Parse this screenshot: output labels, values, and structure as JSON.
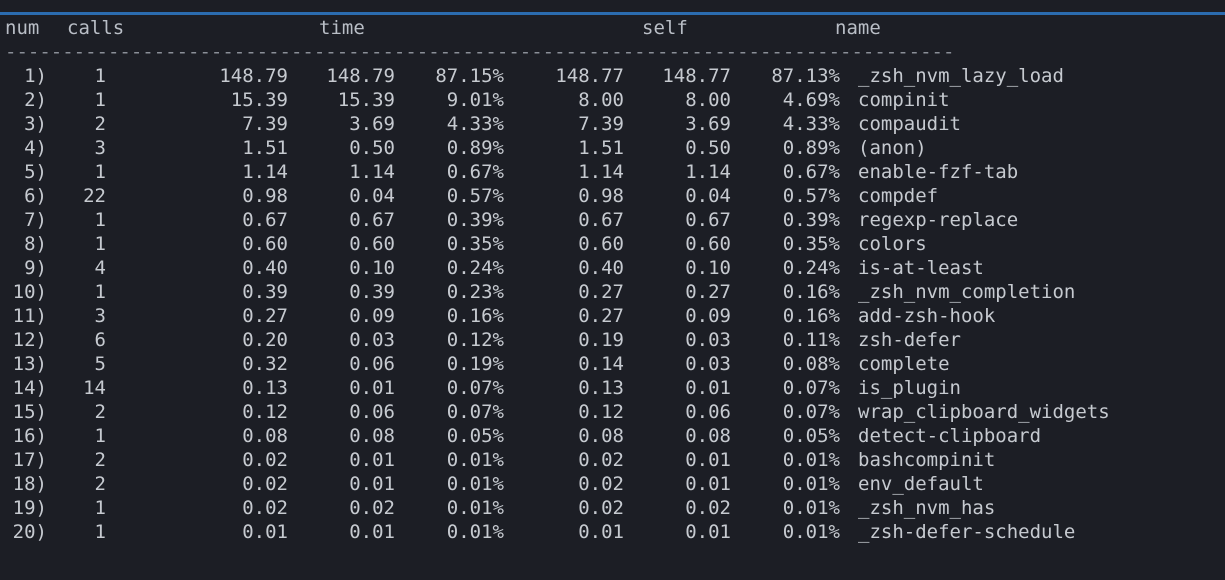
{
  "headers": {
    "num": "num",
    "calls": "calls",
    "time": "time",
    "self": "self",
    "name": "name"
  },
  "rule": "-----------------------------------------------------------------------------------",
  "rows": [
    {
      "num": "1)",
      "calls": "1",
      "time_total": "148.79",
      "time_per": "148.79",
      "time_pct": "87.15%",
      "self_total": "148.77",
      "self_per": "148.77",
      "self_pct": "87.13%",
      "name": "_zsh_nvm_lazy_load"
    },
    {
      "num": "2)",
      "calls": "1",
      "time_total": "15.39",
      "time_per": "15.39",
      "time_pct": "9.01%",
      "self_total": "8.00",
      "self_per": "8.00",
      "self_pct": "4.69%",
      "name": "compinit"
    },
    {
      "num": "3)",
      "calls": "2",
      "time_total": "7.39",
      "time_per": "3.69",
      "time_pct": "4.33%",
      "self_total": "7.39",
      "self_per": "3.69",
      "self_pct": "4.33%",
      "name": "compaudit"
    },
    {
      "num": "4)",
      "calls": "3",
      "time_total": "1.51",
      "time_per": "0.50",
      "time_pct": "0.89%",
      "self_total": "1.51",
      "self_per": "0.50",
      "self_pct": "0.89%",
      "name": "(anon)"
    },
    {
      "num": "5)",
      "calls": "1",
      "time_total": "1.14",
      "time_per": "1.14",
      "time_pct": "0.67%",
      "self_total": "1.14",
      "self_per": "1.14",
      "self_pct": "0.67%",
      "name": "enable-fzf-tab"
    },
    {
      "num": "6)",
      "calls": "22",
      "time_total": "0.98",
      "time_per": "0.04",
      "time_pct": "0.57%",
      "self_total": "0.98",
      "self_per": "0.04",
      "self_pct": "0.57%",
      "name": "compdef"
    },
    {
      "num": "7)",
      "calls": "1",
      "time_total": "0.67",
      "time_per": "0.67",
      "time_pct": "0.39%",
      "self_total": "0.67",
      "self_per": "0.67",
      "self_pct": "0.39%",
      "name": "regexp-replace"
    },
    {
      "num": "8)",
      "calls": "1",
      "time_total": "0.60",
      "time_per": "0.60",
      "time_pct": "0.35%",
      "self_total": "0.60",
      "self_per": "0.60",
      "self_pct": "0.35%",
      "name": "colors"
    },
    {
      "num": "9)",
      "calls": "4",
      "time_total": "0.40",
      "time_per": "0.10",
      "time_pct": "0.24%",
      "self_total": "0.40",
      "self_per": "0.10",
      "self_pct": "0.24%",
      "name": "is-at-least"
    },
    {
      "num": "10)",
      "calls": "1",
      "time_total": "0.39",
      "time_per": "0.39",
      "time_pct": "0.23%",
      "self_total": "0.27",
      "self_per": "0.27",
      "self_pct": "0.16%",
      "name": "_zsh_nvm_completion"
    },
    {
      "num": "11)",
      "calls": "3",
      "time_total": "0.27",
      "time_per": "0.09",
      "time_pct": "0.16%",
      "self_total": "0.27",
      "self_per": "0.09",
      "self_pct": "0.16%",
      "name": "add-zsh-hook"
    },
    {
      "num": "12)",
      "calls": "6",
      "time_total": "0.20",
      "time_per": "0.03",
      "time_pct": "0.12%",
      "self_total": "0.19",
      "self_per": "0.03",
      "self_pct": "0.11%",
      "name": "zsh-defer"
    },
    {
      "num": "13)",
      "calls": "5",
      "time_total": "0.32",
      "time_per": "0.06",
      "time_pct": "0.19%",
      "self_total": "0.14",
      "self_per": "0.03",
      "self_pct": "0.08%",
      "name": "complete"
    },
    {
      "num": "14)",
      "calls": "14",
      "time_total": "0.13",
      "time_per": "0.01",
      "time_pct": "0.07%",
      "self_total": "0.13",
      "self_per": "0.01",
      "self_pct": "0.07%",
      "name": "is_plugin"
    },
    {
      "num": "15)",
      "calls": "2",
      "time_total": "0.12",
      "time_per": "0.06",
      "time_pct": "0.07%",
      "self_total": "0.12",
      "self_per": "0.06",
      "self_pct": "0.07%",
      "name": "wrap_clipboard_widgets"
    },
    {
      "num": "16)",
      "calls": "1",
      "time_total": "0.08",
      "time_per": "0.08",
      "time_pct": "0.05%",
      "self_total": "0.08",
      "self_per": "0.08",
      "self_pct": "0.05%",
      "name": "detect-clipboard"
    },
    {
      "num": "17)",
      "calls": "2",
      "time_total": "0.02",
      "time_per": "0.01",
      "time_pct": "0.01%",
      "self_total": "0.02",
      "self_per": "0.01",
      "self_pct": "0.01%",
      "name": "bashcompinit"
    },
    {
      "num": "18)",
      "calls": "2",
      "time_total": "0.02",
      "time_per": "0.01",
      "time_pct": "0.01%",
      "self_total": "0.02",
      "self_per": "0.01",
      "self_pct": "0.01%",
      "name": "env_default"
    },
    {
      "num": "19)",
      "calls": "1",
      "time_total": "0.02",
      "time_per": "0.02",
      "time_pct": "0.01%",
      "self_total": "0.02",
      "self_per": "0.02",
      "self_pct": "0.01%",
      "name": "_zsh_nvm_has"
    },
    {
      "num": "20)",
      "calls": "1",
      "time_total": "0.01",
      "time_per": "0.01",
      "time_pct": "0.01%",
      "self_total": "0.01",
      "self_per": "0.01",
      "self_pct": "0.01%",
      "name": "_zsh-defer-schedule"
    }
  ],
  "colors": {
    "background": "#1c1e25",
    "text": "#c6cad0",
    "accent": "#2b6cb0"
  }
}
